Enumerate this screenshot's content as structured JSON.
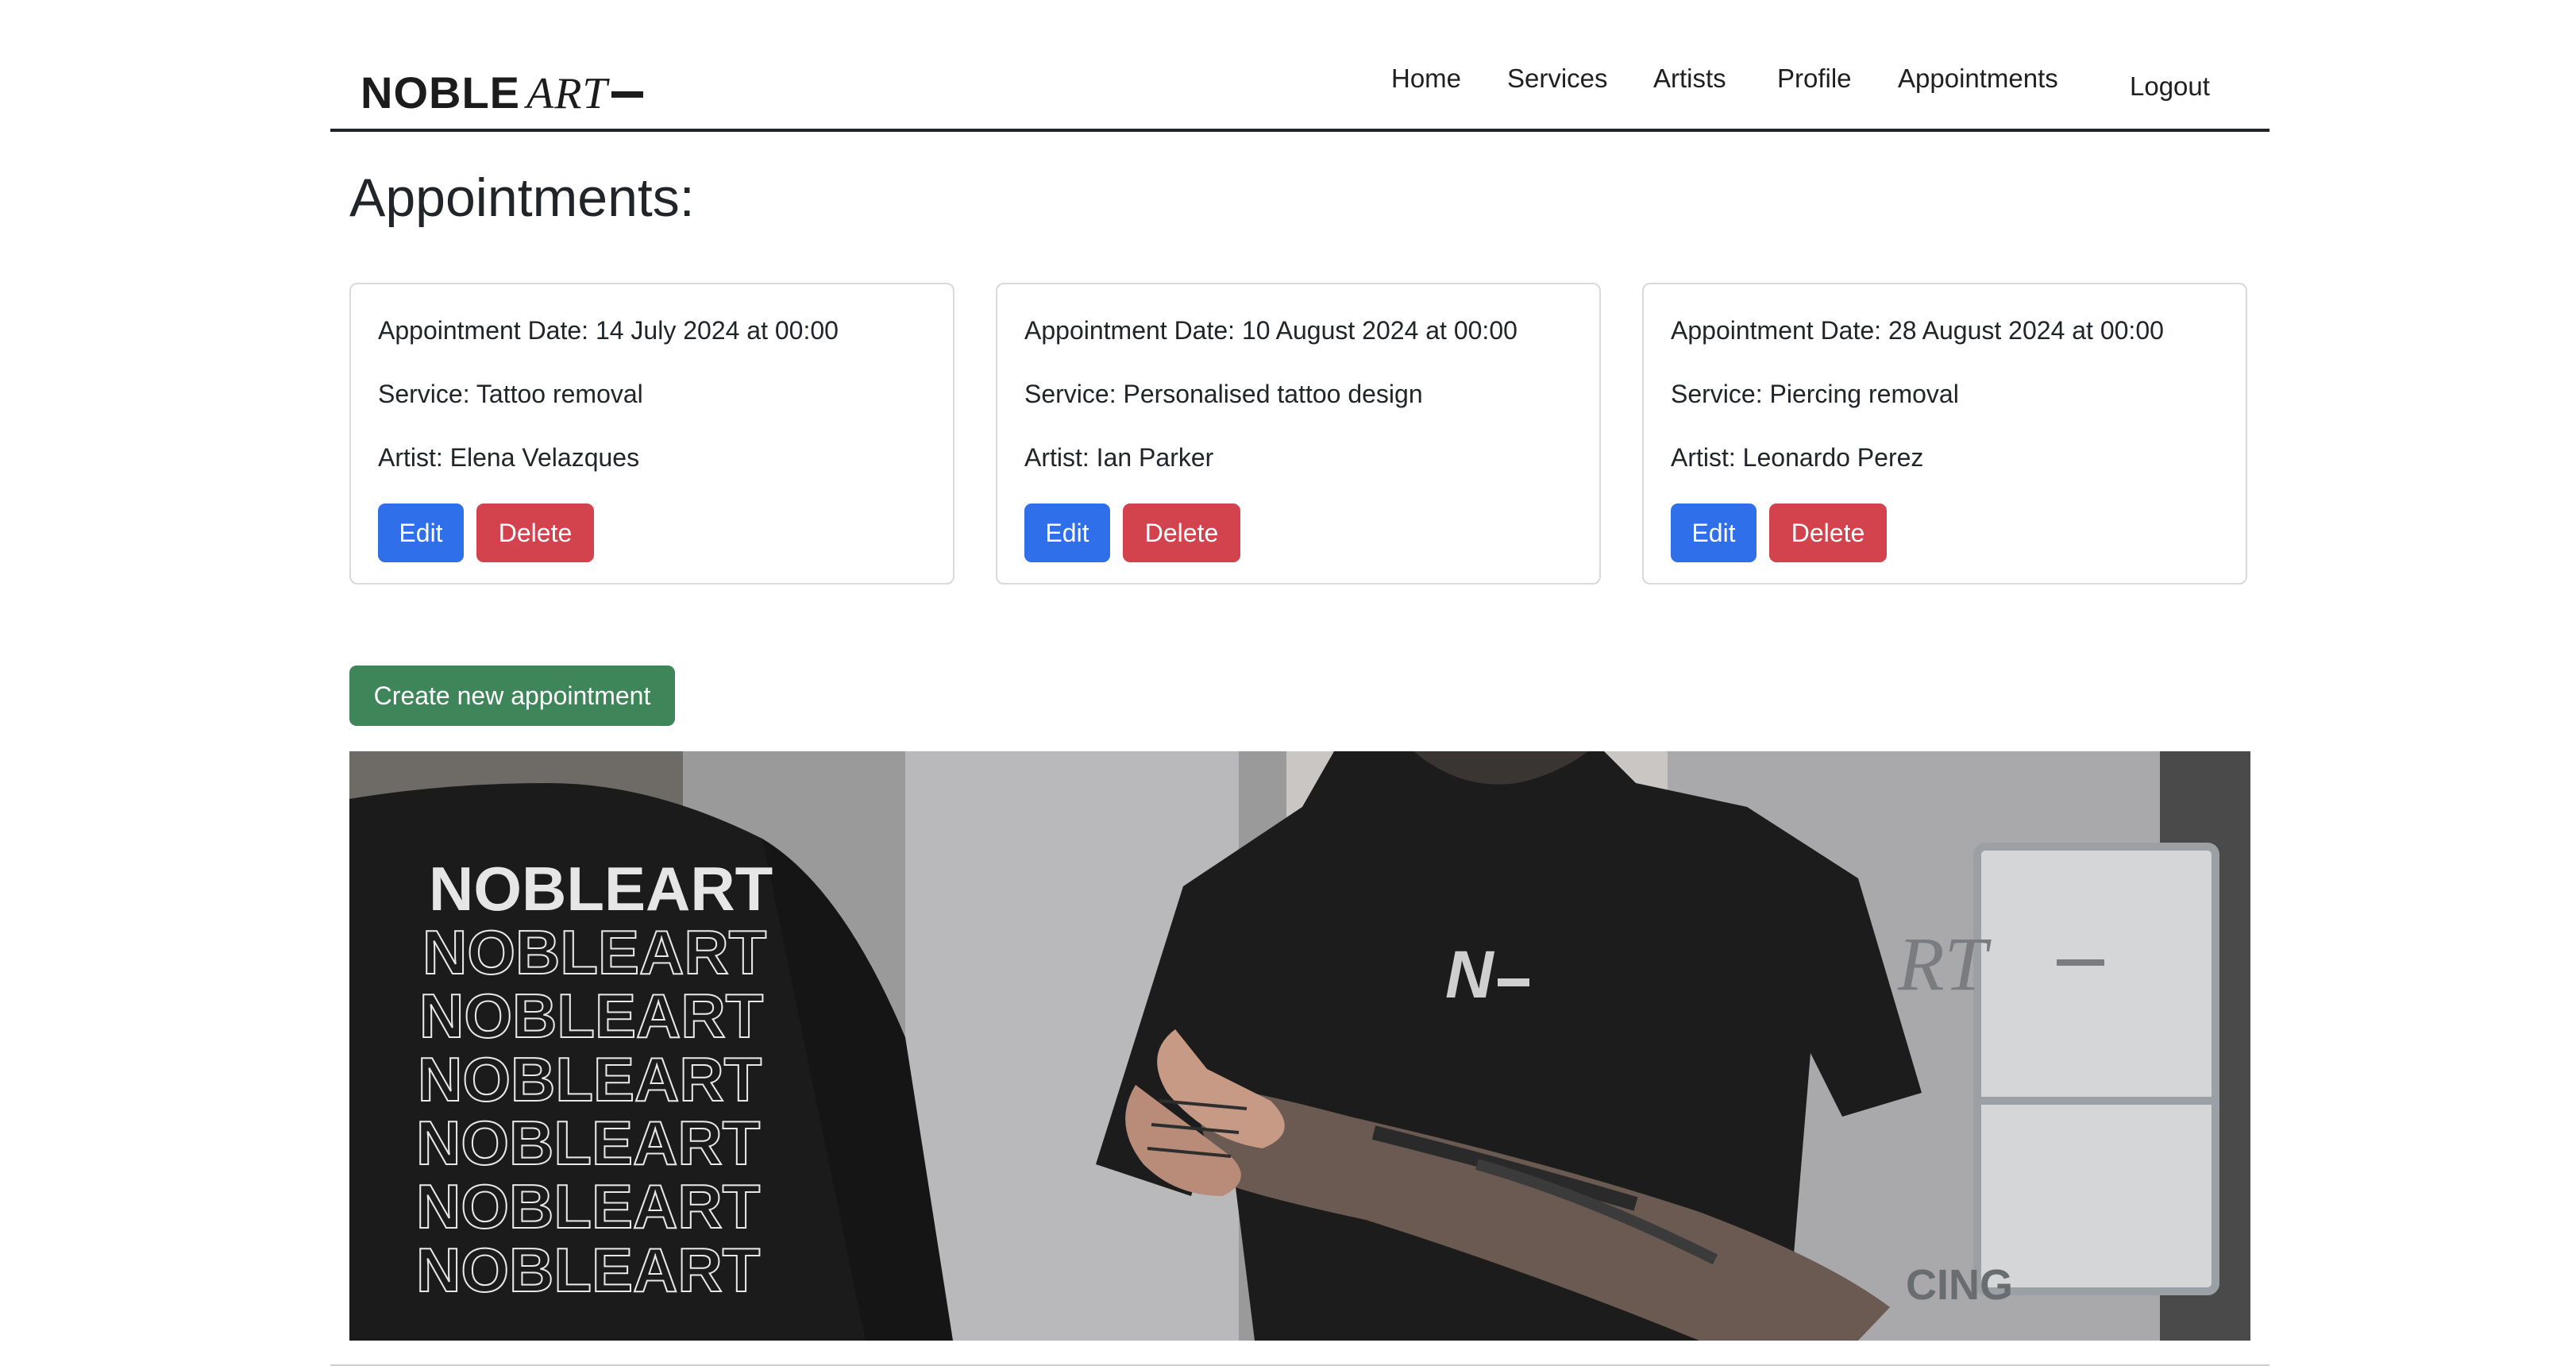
{
  "header": {
    "logo_main": "NOBLE",
    "logo_italic": "ART",
    "nav": {
      "home": "Home",
      "services": "Services",
      "artists": "Artists",
      "profile": "Profile",
      "appointments": "Appointments",
      "logout": "Logout"
    }
  },
  "page_title": "Appointments:",
  "appointments": [
    {
      "date": "Appointment Date: 14 July 2024 at 00:00",
      "service": "Service: Tattoo removal",
      "artist": "Artist: Elena Velazques",
      "edit_label": "Edit",
      "delete_label": "Delete"
    },
    {
      "date": "Appointment Date: 10 August 2024 at 00:00",
      "service": "Service: Personalised tattoo design",
      "artist": "Artist: Ian Parker",
      "edit_label": "Edit",
      "delete_label": "Delete"
    },
    {
      "date": "Appointment Date: 28 August 2024 at 00:00",
      "service": "Service: Piercing removal",
      "artist": "Artist: Leonardo Perez",
      "edit_label": "Edit",
      "delete_label": "Delete"
    }
  ],
  "create_button": "Create new appointment",
  "hero_image": {
    "shirt_back_text": "NOBLEART",
    "shirt_front_text": "N",
    "sign_text": "RT",
    "case_text": "CING"
  },
  "colors": {
    "edit": "#2f6fea",
    "delete": "#d2434e",
    "create": "#3f855a",
    "text": "#212529"
  }
}
